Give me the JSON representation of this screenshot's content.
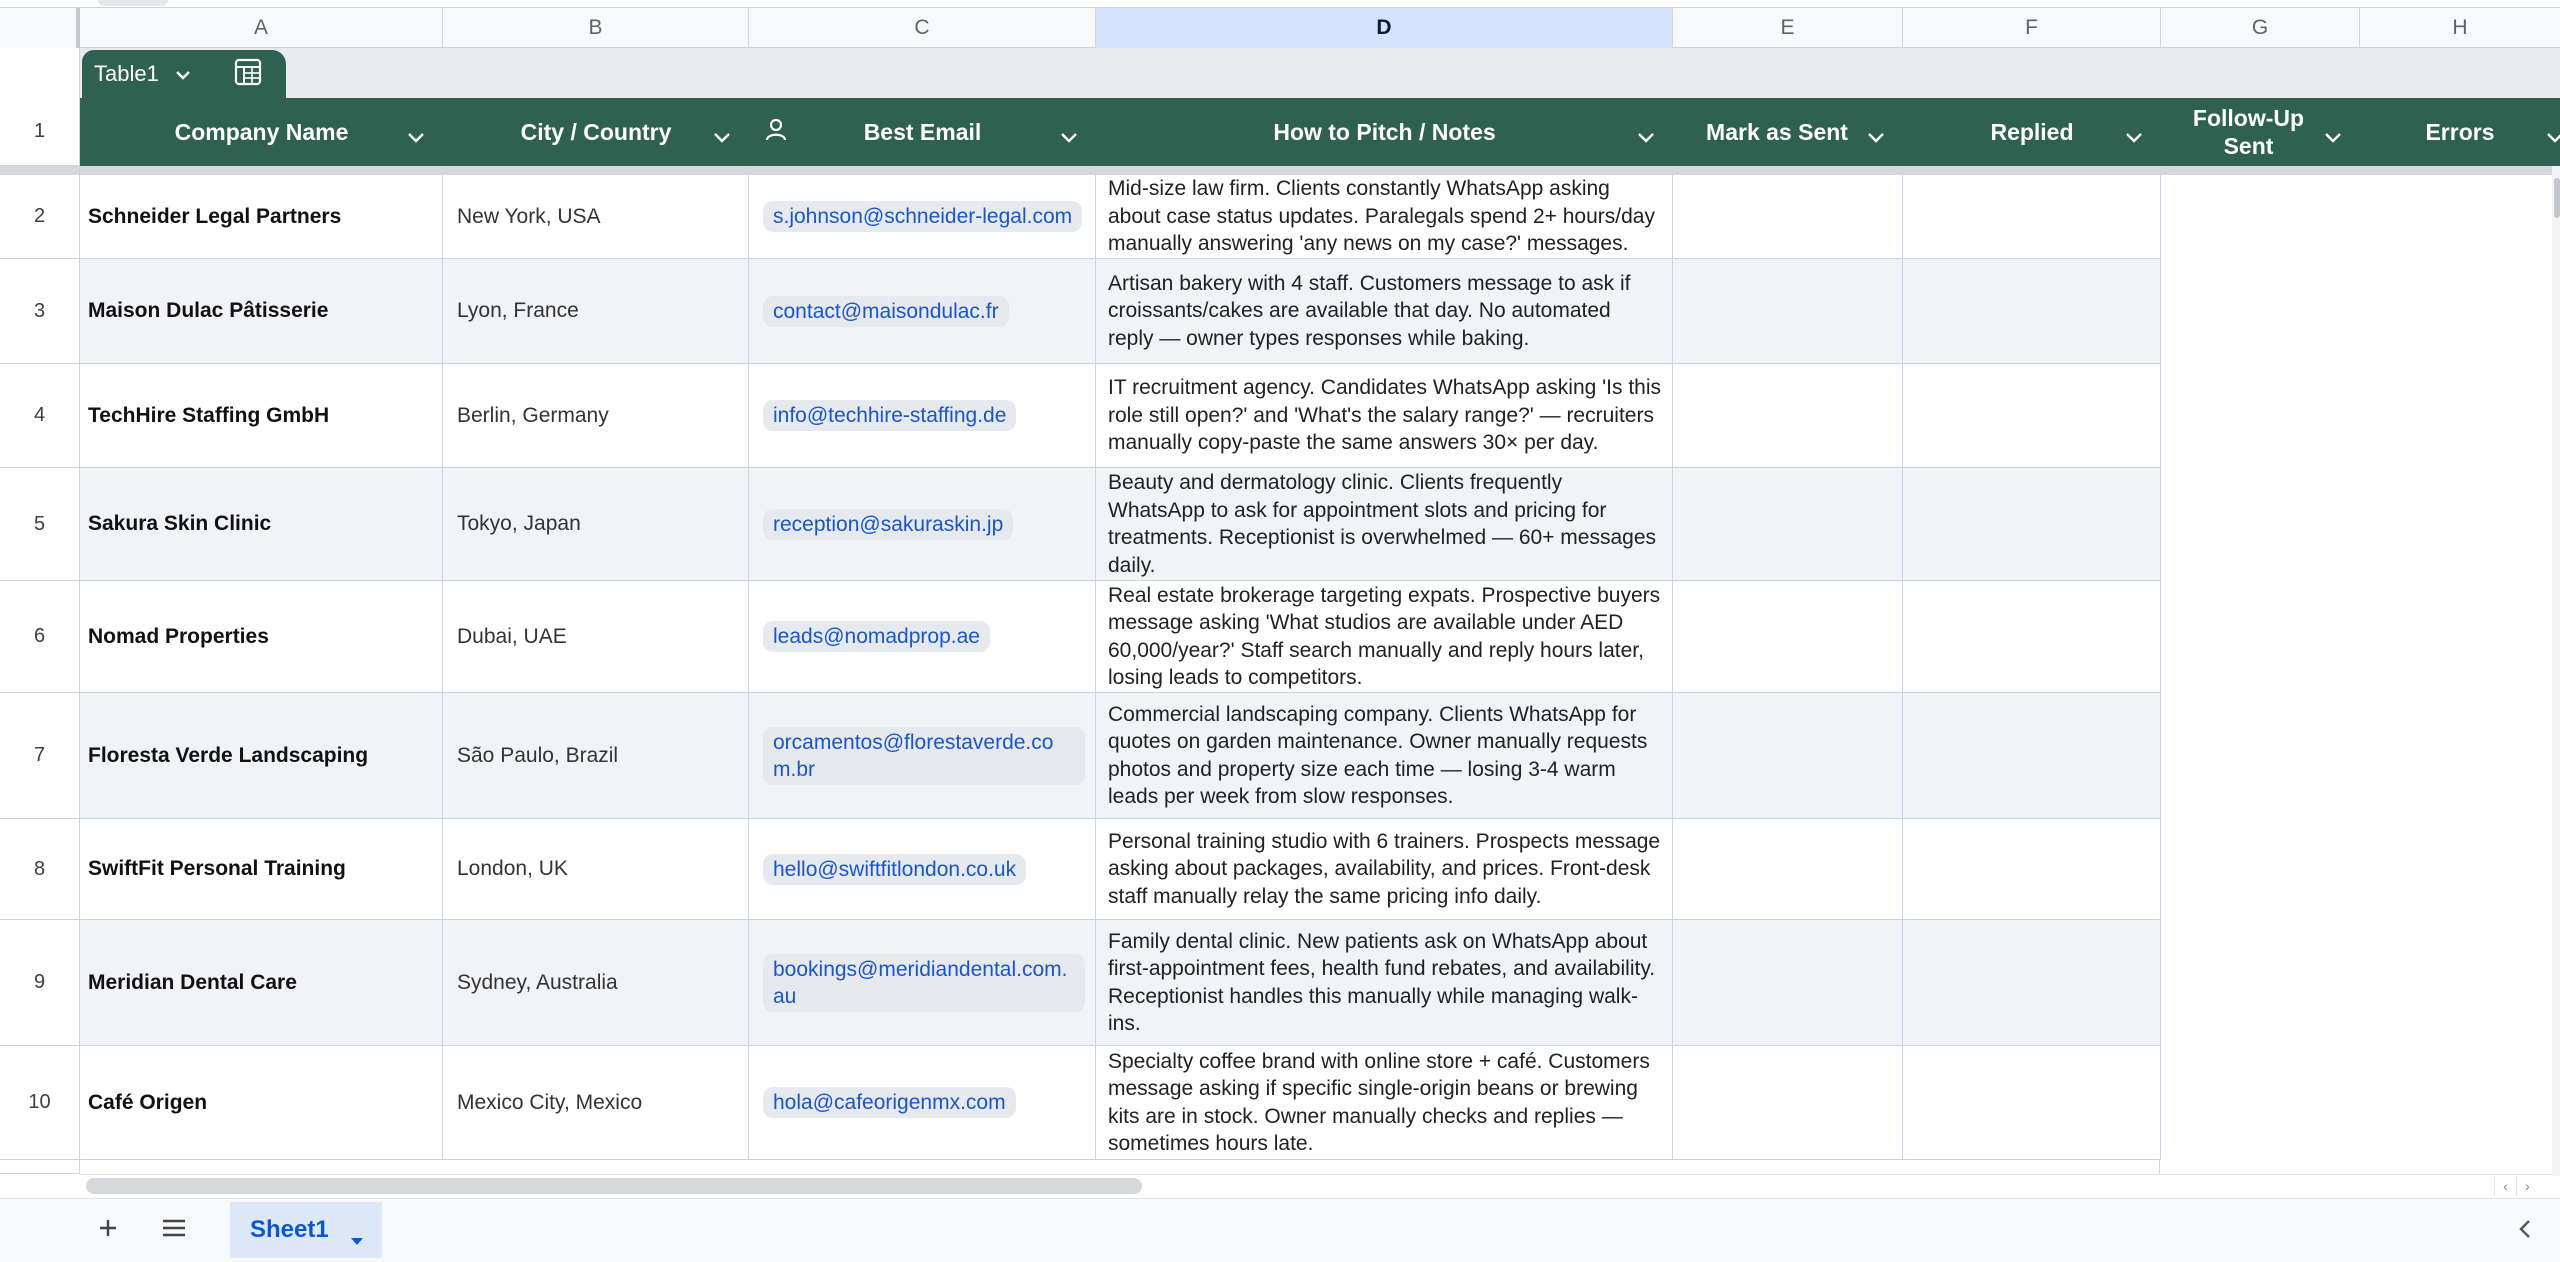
{
  "columns": [
    "A",
    "B",
    "C",
    "D",
    "E",
    "F",
    "G",
    "H"
  ],
  "table": {
    "name": "Table1",
    "headers": [
      "Company Name",
      "City / Country",
      "Best Email",
      "How to Pitch / Notes",
      "Mark as Sent",
      "Replied",
      "Follow-Up Sent",
      "Errors"
    ],
    "header_row_number": "1"
  },
  "rows": [
    {
      "num": "2",
      "company": "Schneider Legal Partners",
      "city": "New York, USA",
      "email": "s.johnson@schneider-legal.com",
      "notes": "Mid-size law firm. Clients constantly WhatsApp asking about case status updates. Paralegals spend 2+ hours/day manually answering 'any news on my case?' messages."
    },
    {
      "num": "3",
      "company": "Maison Dulac Pâtisserie",
      "city": "Lyon, France",
      "email": "contact@maisondulac.fr",
      "notes": "Artisan bakery with 4 staff. Customers message to ask if croissants/cakes are available that day. No automated reply — owner types responses while baking."
    },
    {
      "num": "4",
      "company": "TechHire Staffing GmbH",
      "city": "Berlin, Germany",
      "email": "info@techhire-staffing.de",
      "notes": "IT recruitment agency. Candidates WhatsApp asking 'Is this role still open?' and 'What's the salary range?' — recruiters manually copy-paste the same answers 30× per day."
    },
    {
      "num": "5",
      "company": "Sakura Skin Clinic",
      "city": "Tokyo, Japan",
      "email": "reception@sakuraskin.jp",
      "notes": "Beauty and dermatology clinic. Clients frequently WhatsApp to ask for appointment slots and pricing for treatments. Receptionist is overwhelmed — 60+ messages daily."
    },
    {
      "num": "6",
      "company": "Nomad Properties",
      "city": "Dubai, UAE",
      "email": "leads@nomadprop.ae",
      "notes": "Real estate brokerage targeting expats. Prospective buyers message asking 'What studios are available under AED 60,000/year?' Staff search manually and reply hours later, losing leads to competitors."
    },
    {
      "num": "7",
      "company": "Floresta Verde Landscaping",
      "city": "São Paulo, Brazil",
      "email": "orcamentos@florestaverde.com.br",
      "notes": "Commercial landscaping company. Clients WhatsApp for quotes on garden maintenance. Owner manually requests photos and property size each time — losing 3-4 warm leads per week from slow responses."
    },
    {
      "num": "8",
      "company": "SwiftFit Personal Training",
      "city": "London, UK",
      "email": "hello@swiftfitlondon.co.uk",
      "notes": "Personal training studio with 6 trainers. Prospects message asking about packages, availability, and prices. Front-desk staff manually relay the same pricing info daily."
    },
    {
      "num": "9",
      "company": "Meridian Dental Care",
      "city": "Sydney, Australia",
      "email": "bookings@meridiandental.com.au",
      "notes": "Family dental clinic. New patients ask on WhatsApp about first-appointment fees, health fund rebates, and availability. Receptionist handles this manually while managing walk-ins."
    },
    {
      "num": "10",
      "company": "Café Origen",
      "city": "Mexico City, Mexico",
      "email": "hola@cafeorigenmx.com",
      "notes": "Specialty coffee brand with online store + café. Customers message asking if specific single-origin beans or brewing kits are in stock. Owner manually checks and replies — sometimes hours late."
    }
  ],
  "sheets": {
    "active": "Sheet1"
  },
  "icons": {
    "dropdown": "chevron-down-icon",
    "table_tool": "table-icon",
    "person": "person-chip-icon",
    "add": "plus-icon",
    "all_sheets": "menu-icon",
    "collapse": "chevron-left-icon"
  },
  "colors": {
    "table_header": "#2e6150",
    "selected_column": "#d3e3fd",
    "email_chip_text": "#1a56c9",
    "active_tab": "#0b57d0"
  }
}
